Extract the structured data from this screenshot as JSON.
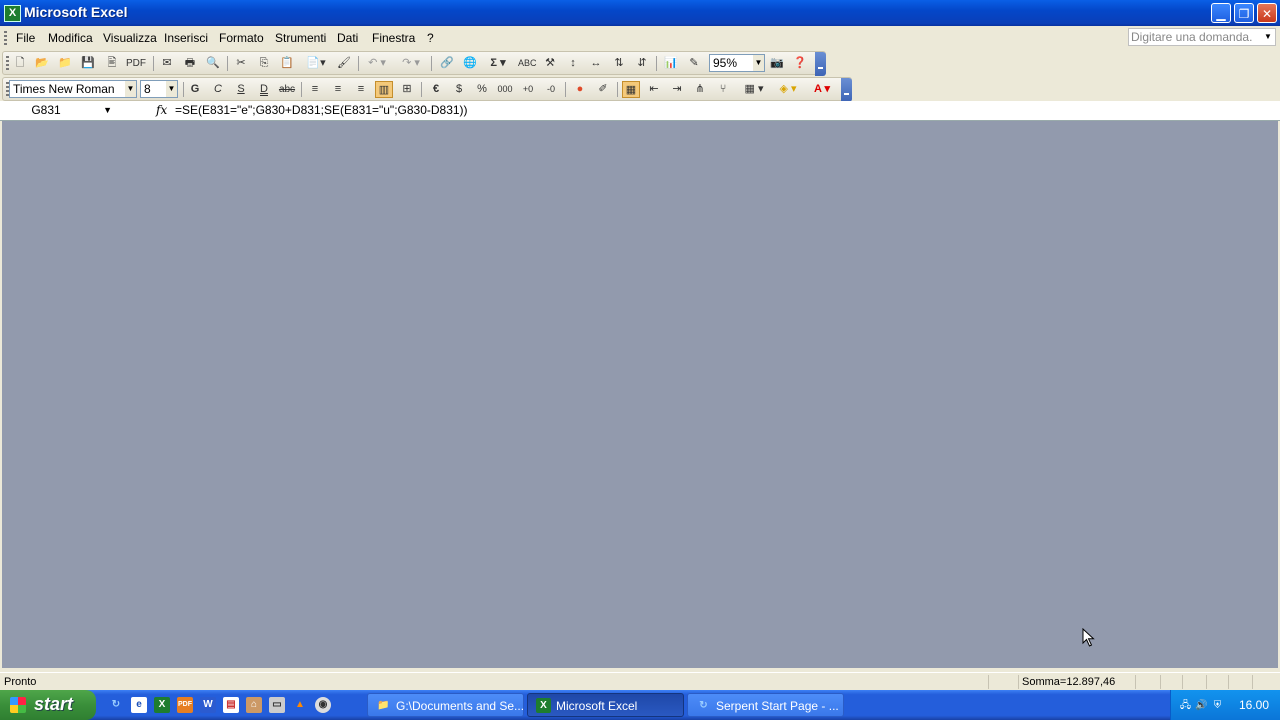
{
  "window": {
    "title": "Microsoft Excel"
  },
  "menu": {
    "items": [
      "File",
      "Modifica",
      "Visualizza",
      "Inserisci",
      "Formato",
      "Strumenti",
      "Dati",
      "Finestra",
      "?"
    ],
    "ask_placeholder": "Digitare una domanda."
  },
  "standard_toolbar": {
    "pdf_label": "PDF",
    "zoom": "95%"
  },
  "format_toolbar": {
    "font_name": "Times New Roman",
    "font_size": "8",
    "bold_label": "G",
    "italic_label": "C",
    "underline_label": "S",
    "double_underline_label": "D",
    "strikethrough_label": "abc",
    "euro_label": "€",
    "dollar_label": "$",
    "percent_label": "%",
    "thousands_label": "000"
  },
  "formula_bar": {
    "cell_ref": "G831",
    "fx_label": "fx",
    "formula": "=SE(E831=\"e\";G830+D831;SE(E831=\"u\";G830-D831))"
  },
  "status_bar": {
    "status": "Pronto",
    "sum": "Somma=12.897,46"
  },
  "taskbar": {
    "start_label": "start",
    "tasks": [
      {
        "label": "G:\\Documents and Se..."
      },
      {
        "label": "Microsoft Excel"
      },
      {
        "label": "Serpent Start Page - ..."
      }
    ],
    "clock": "16.00"
  },
  "colors": {
    "workspace": "#929aad",
    "titlebar": "#0a5fe6",
    "taskbar": "#245edb",
    "start": "#3a8f3a"
  }
}
